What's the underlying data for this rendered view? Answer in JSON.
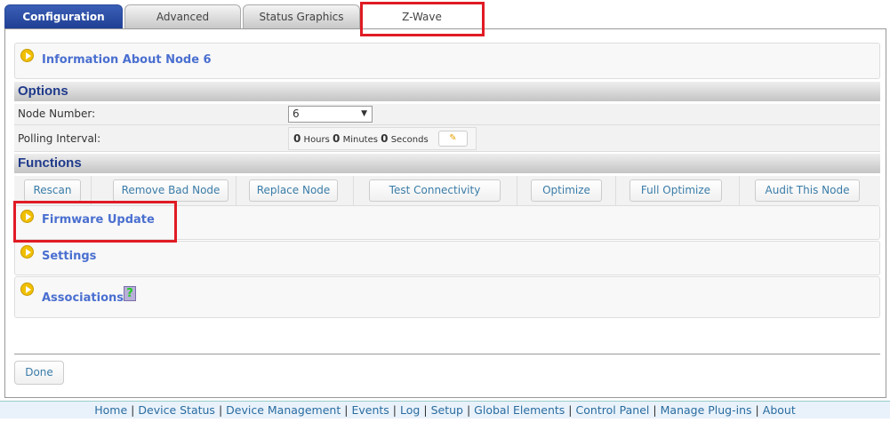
{
  "tabs": [
    "Configuration",
    "Advanced",
    "Status Graphics",
    "Z-Wave"
  ],
  "info_panel": "Information About Node 6",
  "options": {
    "title": "Options",
    "node_number_label": "Node Number:",
    "node_number_value": "6",
    "polling_label": "Polling Interval:",
    "hours": "0",
    "hours_label": "Hours",
    "minutes": "0",
    "minutes_label": "Minutes",
    "seconds": "0",
    "seconds_label": "Seconds"
  },
  "functions": {
    "title": "Functions",
    "buttons": [
      "Rescan",
      "Remove Bad Node",
      "Replace Node",
      "Test Connectivity",
      "Optimize",
      "Full Optimize",
      "Audit This Node"
    ]
  },
  "panels": [
    "Firmware Update",
    "Settings",
    "Associations"
  ],
  "done": "Done",
  "footer": [
    "Home",
    "Device Status",
    "Device Management",
    "Events",
    "Log",
    "Setup",
    "Global Elements",
    "Control Panel",
    "Manage Plug-ins",
    "About"
  ]
}
